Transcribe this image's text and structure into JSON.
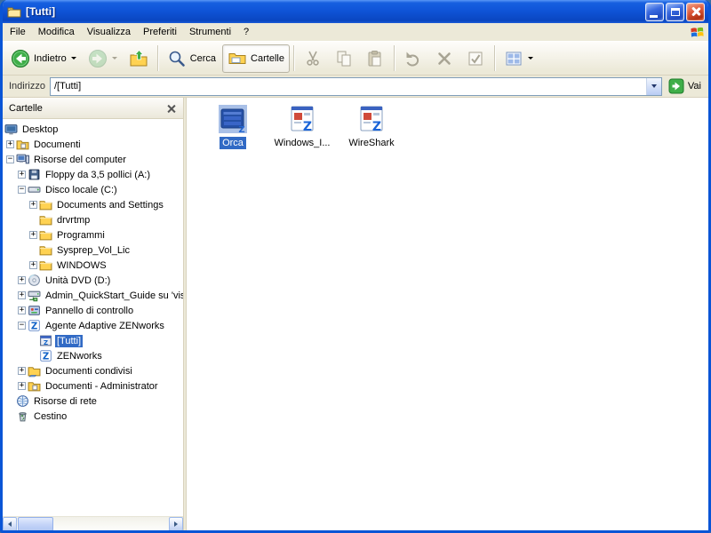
{
  "window": {
    "title": "[Tutti]"
  },
  "menubar": {
    "items": [
      "File",
      "Modifica",
      "Visualizza",
      "Preferiti",
      "Strumenti",
      "?"
    ]
  },
  "toolbar": {
    "buttons": [
      {
        "id": "back",
        "label": "Indietro",
        "dropdown": true
      },
      {
        "id": "forward",
        "dropdown": true,
        "disabled": true
      },
      {
        "id": "up"
      },
      {
        "sep": true
      },
      {
        "id": "search",
        "label": "Cerca"
      },
      {
        "id": "folders",
        "label": "Cartelle",
        "pressed": true
      },
      {
        "sep": true
      },
      {
        "id": "cut",
        "disabled": true
      },
      {
        "id": "copy",
        "disabled": true
      },
      {
        "id": "paste",
        "disabled": true
      },
      {
        "sep": true
      },
      {
        "id": "undo",
        "disabled": true
      },
      {
        "id": "delete",
        "disabled": true
      },
      {
        "id": "properties",
        "disabled": true
      },
      {
        "sep": true
      },
      {
        "id": "views",
        "dropdown": true
      }
    ]
  },
  "addressbar": {
    "label": "Indirizzo",
    "value": "/[Tutti]",
    "go": "Vai"
  },
  "folders_pane": {
    "header": "Cartelle",
    "items": [
      {
        "label": "Desktop",
        "level": 0,
        "expander": "none",
        "icon": "desktop"
      },
      {
        "label": "Documenti",
        "level": 1,
        "expander": "plus",
        "icon": "mydocs"
      },
      {
        "label": "Risorse del computer",
        "level": 1,
        "expander": "minus",
        "icon": "computer"
      },
      {
        "label": "Floppy da 3,5 pollici (A:)",
        "level": 2,
        "expander": "plus",
        "icon": "floppy"
      },
      {
        "label": "Disco locale (C:)",
        "level": 2,
        "expander": "minus",
        "icon": "drive"
      },
      {
        "label": "Documents and Settings",
        "level": 3,
        "expander": "plus",
        "icon": "folder"
      },
      {
        "label": "drvrtmp",
        "level": 3,
        "expander": "none",
        "icon": "folder"
      },
      {
        "label": "Programmi",
        "level": 3,
        "expander": "plus",
        "icon": "folder"
      },
      {
        "label": "Sysprep_Vol_Lic",
        "level": 3,
        "expander": "none",
        "icon": "folder"
      },
      {
        "label": "WINDOWS",
        "level": 3,
        "expander": "plus",
        "icon": "folder"
      },
      {
        "label": "Unità DVD (D:)",
        "level": 2,
        "expander": "plus",
        "icon": "dvd"
      },
      {
        "label": "Admin_QuickStart_Guide su 'vista",
        "level": 2,
        "expander": "plus",
        "icon": "netdrive"
      },
      {
        "label": "Pannello di controllo",
        "level": 2,
        "expander": "plus",
        "icon": "controlpanel"
      },
      {
        "label": "Agente Adaptive ZENworks",
        "level": 2,
        "expander": "minus",
        "icon": "zenapp"
      },
      {
        "label": "[Tutti]",
        "level": 3,
        "expander": "none",
        "icon": "tutti",
        "selected": true
      },
      {
        "label": "ZENworks",
        "level": 3,
        "expander": "none",
        "icon": "zenapp"
      },
      {
        "label": "Documenti condivisi",
        "level": 2,
        "expander": "plus",
        "icon": "sharedfolder"
      },
      {
        "label": "Documenti - Administrator",
        "level": 2,
        "expander": "plus",
        "icon": "mydocs"
      },
      {
        "label": "Risorse di rete",
        "level": 1,
        "expander": "none",
        "icon": "network"
      },
      {
        "label": "Cestino",
        "level": 1,
        "expander": "none",
        "icon": "recycle"
      }
    ]
  },
  "files": {
    "items": [
      {
        "name": "Orca",
        "icon": "orca",
        "selected": true
      },
      {
        "name": "Windows_I...",
        "icon": "zendoc",
        "selected": false
      },
      {
        "name": "WireShark",
        "icon": "zendoc",
        "selected": false
      }
    ]
  },
  "theme": {
    "selection_color": "#316ac5",
    "titlebar_color": "#0f54d8",
    "window_border_color": "#0a55d6",
    "go_button_color": "#3fae49",
    "toolbar_bg": "#ece9d8"
  }
}
